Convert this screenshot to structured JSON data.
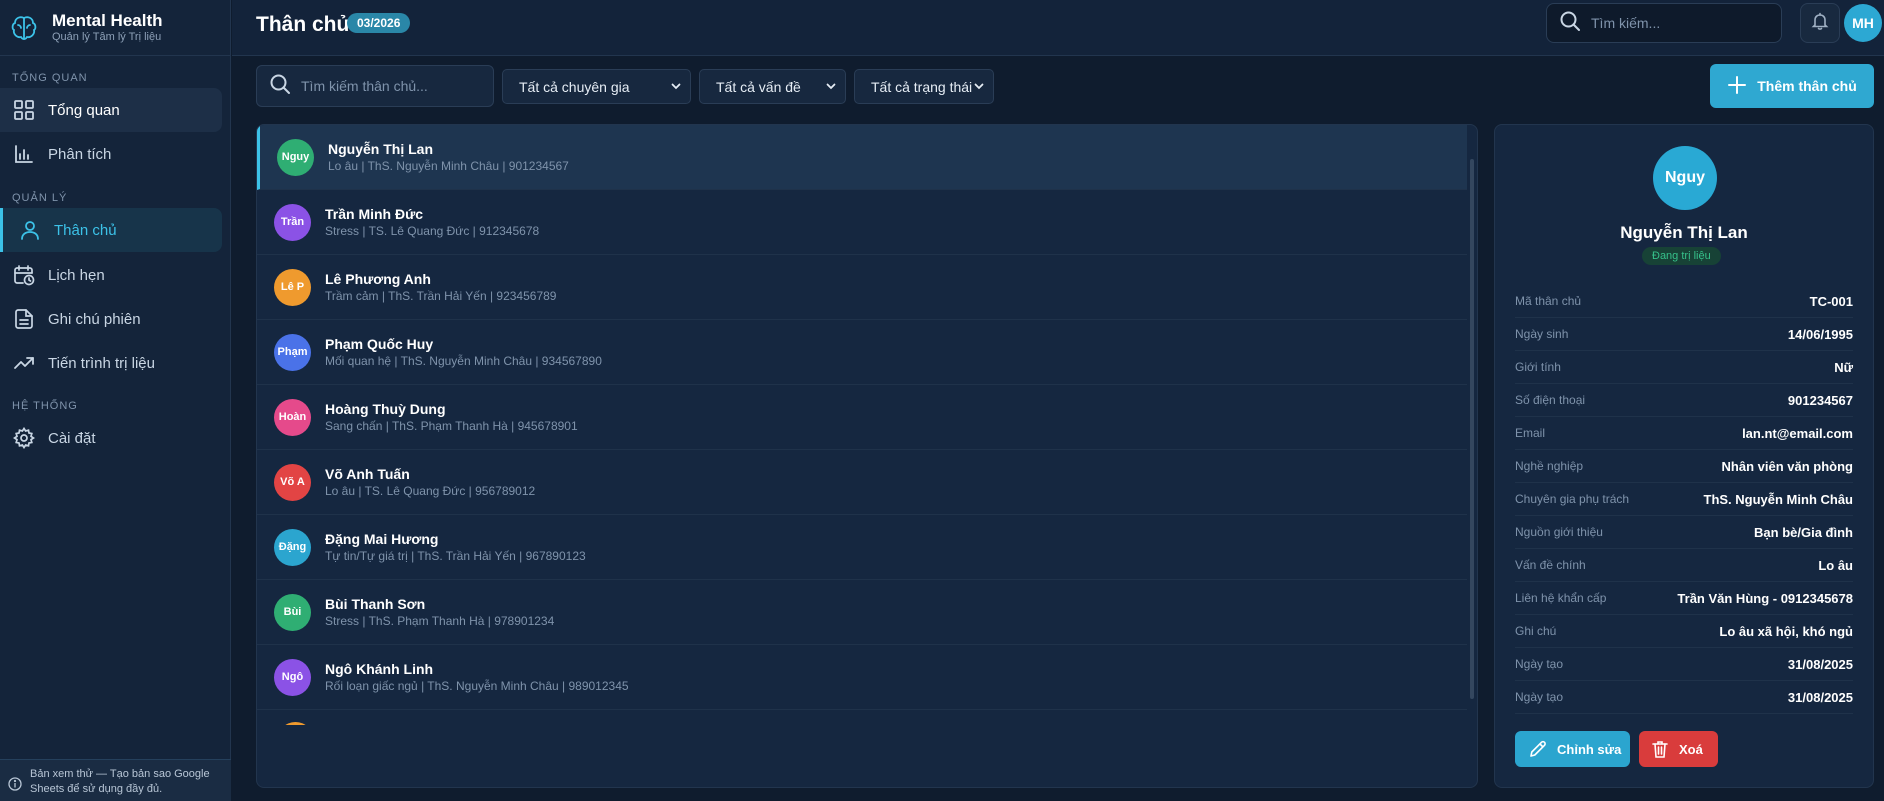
{
  "brand": {
    "title": "Mental Health",
    "subtitle": "Quản lý Tâm lý Trị liệu"
  },
  "sidebar": {
    "sections": {
      "overview": "TỔNG QUAN",
      "manage": "QUẢN LÝ",
      "system": "HỆ THỐNG"
    },
    "items": [
      {
        "label": "Tổng quan",
        "icon": "grid-icon"
      },
      {
        "label": "Phân tích",
        "icon": "bar-chart-icon"
      },
      {
        "label": "Thân chủ",
        "icon": "user-icon"
      },
      {
        "label": "Lịch hẹn",
        "icon": "calendar-clock-icon"
      },
      {
        "label": "Ghi chú phiên",
        "icon": "document-icon"
      },
      {
        "label": "Tiến trình trị liệu",
        "icon": "trending-up-icon"
      },
      {
        "label": "Cài đặt",
        "icon": "gear-icon"
      }
    ],
    "footer": "Bản xem thử — Tạo bản sao Google Sheets để sử dụng đầy đủ."
  },
  "header": {
    "title": "Thân chủ",
    "date_badge": "03/2026",
    "search_placeholder": "Tìm kiếm...",
    "avatar": "MH"
  },
  "filters": {
    "search_placeholder": "Tìm kiếm thân chủ...",
    "expert": "Tất cả chuyên gia",
    "issue": "Tất cả vấn đề",
    "status": "Tất cả trạng thái",
    "add_button": "Thêm thân chủ"
  },
  "clients": [
    {
      "initials": "Nguy",
      "name": "Nguyễn Thị Lan",
      "sub": "Lo âu | ThS. Nguyễn Minh Châu | 901234567",
      "color": "#2fae73"
    },
    {
      "initials": "Trần",
      "name": "Trần Minh Đức",
      "sub": "Stress | TS. Lê Quang Đức | 912345678",
      "color": "#8b52e6"
    },
    {
      "initials": "Lê P",
      "name": "Lê Phương Anh",
      "sub": "Trầm cảm | ThS. Trần Hải Yến | 923456789",
      "color": "#ef9a2e"
    },
    {
      "initials": "Phạm",
      "name": "Phạm Quốc Huy",
      "sub": "Mối quan hệ | ThS. Nguyễn Minh Châu | 934567890",
      "color": "#4a72e8"
    },
    {
      "initials": "Hoàn",
      "name": "Hoàng Thuỳ Dung",
      "sub": "Sang chấn | ThS. Phạm Thanh Hà | 945678901",
      "color": "#e54a8b"
    },
    {
      "initials": "Võ A",
      "name": "Võ Anh Tuấn",
      "sub": "Lo âu | TS. Lê Quang Đức | 956789012",
      "color": "#e24444"
    },
    {
      "initials": "Đặng",
      "name": "Đặng Mai Hương",
      "sub": "Tự tin/Tự giá trị | ThS. Trần Hải Yến | 967890123",
      "color": "#2ba5cf"
    },
    {
      "initials": "Bùi",
      "name": "Bùi Thanh Sơn",
      "sub": "Stress | ThS. Phạm Thanh Hà | 978901234",
      "color": "#2fae73"
    },
    {
      "initials": "Ngô",
      "name": "Ngô Khánh Linh",
      "sub": "Rối loạn giấc ngủ | ThS. Nguyễn Minh Châu | 989012345",
      "color": "#8b52e6"
    }
  ],
  "detail": {
    "initials": "Nguy",
    "name": "Nguyễn Thị Lan",
    "status": "Đang trị liệu",
    "fields": [
      {
        "key": "Mã thân chủ",
        "value": "TC-001"
      },
      {
        "key": "Ngày sinh",
        "value": "14/06/1995"
      },
      {
        "key": "Giới tính",
        "value": "Nữ"
      },
      {
        "key": "Số điện thoại",
        "value": "901234567"
      },
      {
        "key": "Email",
        "value": "lan.nt@email.com"
      },
      {
        "key": "Nghề nghiệp",
        "value": "Nhân viên văn phòng"
      },
      {
        "key": "Chuyên gia phụ trách",
        "value": "ThS. Nguyễn Minh Châu"
      },
      {
        "key": "Nguồn giới thiệu",
        "value": "Bạn bè/Gia đình"
      },
      {
        "key": "Vấn đề chính",
        "value": "Lo âu"
      },
      {
        "key": "Liên hệ khẩn cấp",
        "value": "Trần Văn Hùng - 0912345678"
      },
      {
        "key": "Ghi chú",
        "value": "Lo âu xã hội, khó ngủ"
      },
      {
        "key": "Ngày tạo",
        "value": "31/08/2025"
      },
      {
        "key": "Ngày tạo",
        "value": "31/08/2025"
      }
    ],
    "edit_button": "Chỉnh sửa",
    "delete_button": "Xoá"
  },
  "colors": {
    "accent": "#2fa8d1",
    "danger": "#d93c3c",
    "success": "#36c08a"
  }
}
